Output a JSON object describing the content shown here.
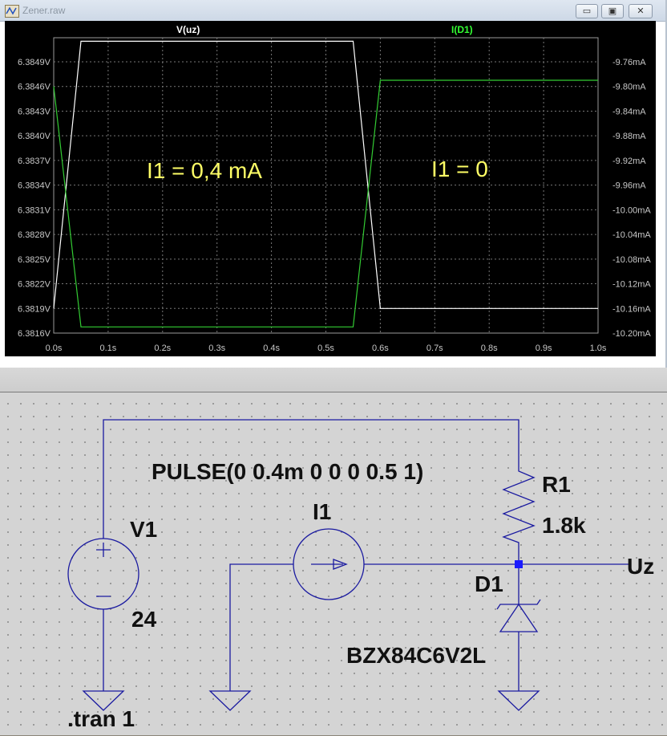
{
  "window": {
    "title": "Zener.raw",
    "buttons": {
      "minimize": "▭",
      "maximize": "▣",
      "close": "✕"
    }
  },
  "plot": {
    "traces": [
      {
        "name": "V(uz)",
        "color": "#ffffff"
      },
      {
        "name": "I(D1)",
        "color": "#33cc33"
      }
    ],
    "annotations": [
      "I1 = 0,4 mA",
      "I1 = 0"
    ]
  },
  "chart_data": {
    "type": "line",
    "xlabel": "",
    "ylabel": "",
    "xlim": [
      0,
      1.0
    ],
    "x_ticks": [
      "0.0s",
      "0.1s",
      "0.2s",
      "0.3s",
      "0.4s",
      "0.5s",
      "0.6s",
      "0.7s",
      "0.8s",
      "0.9s",
      "1.0s"
    ],
    "y_left_ticks": [
      "6.3849V",
      "6.3846V",
      "6.3843V",
      "6.3840V",
      "6.3837V",
      "6.3834V",
      "6.3831V",
      "6.3828V",
      "6.3825V",
      "6.3822V",
      "6.3819V",
      "6.3816V"
    ],
    "y_right_ticks": [
      "-9.76mA",
      "-9.80mA",
      "-9.84mA",
      "-9.88mA",
      "-9.92mA",
      "-9.96mA",
      "-10.00mA",
      "-10.04mA",
      "-10.08mA",
      "-10.12mA",
      "-10.16mA",
      "-10.20mA"
    ],
    "series": [
      {
        "name": "V(uz)",
        "axis": "left",
        "unit": "V",
        "x": [
          0,
          0.05,
          0.55,
          0.6,
          1.0
        ],
        "y": [
          6.3819,
          6.38515,
          6.38515,
          6.3819,
          6.3819
        ]
      },
      {
        "name": "I(D1)",
        "axis": "right",
        "unit": "mA",
        "x": [
          0,
          0.05,
          0.55,
          0.6,
          1.0
        ],
        "y": [
          -9.8,
          -10.19,
          -10.19,
          -9.79,
          -9.79
        ]
      }
    ]
  },
  "schematic": {
    "labels": {
      "pulse": "PULSE(0 0.4m 0 0 0 0.5 1)",
      "v1_name": "V1",
      "v1_value": "24",
      "i1_name": "I1",
      "r1_name": "R1",
      "r1_value": "1.8k",
      "d1_name": "D1",
      "d1_model": "BZX84C6V2L",
      "net_label": "Uz",
      "directive": ".tran 1"
    },
    "colors": {
      "wire": "#1a1aa0",
      "junction": "#1a1aff"
    }
  }
}
